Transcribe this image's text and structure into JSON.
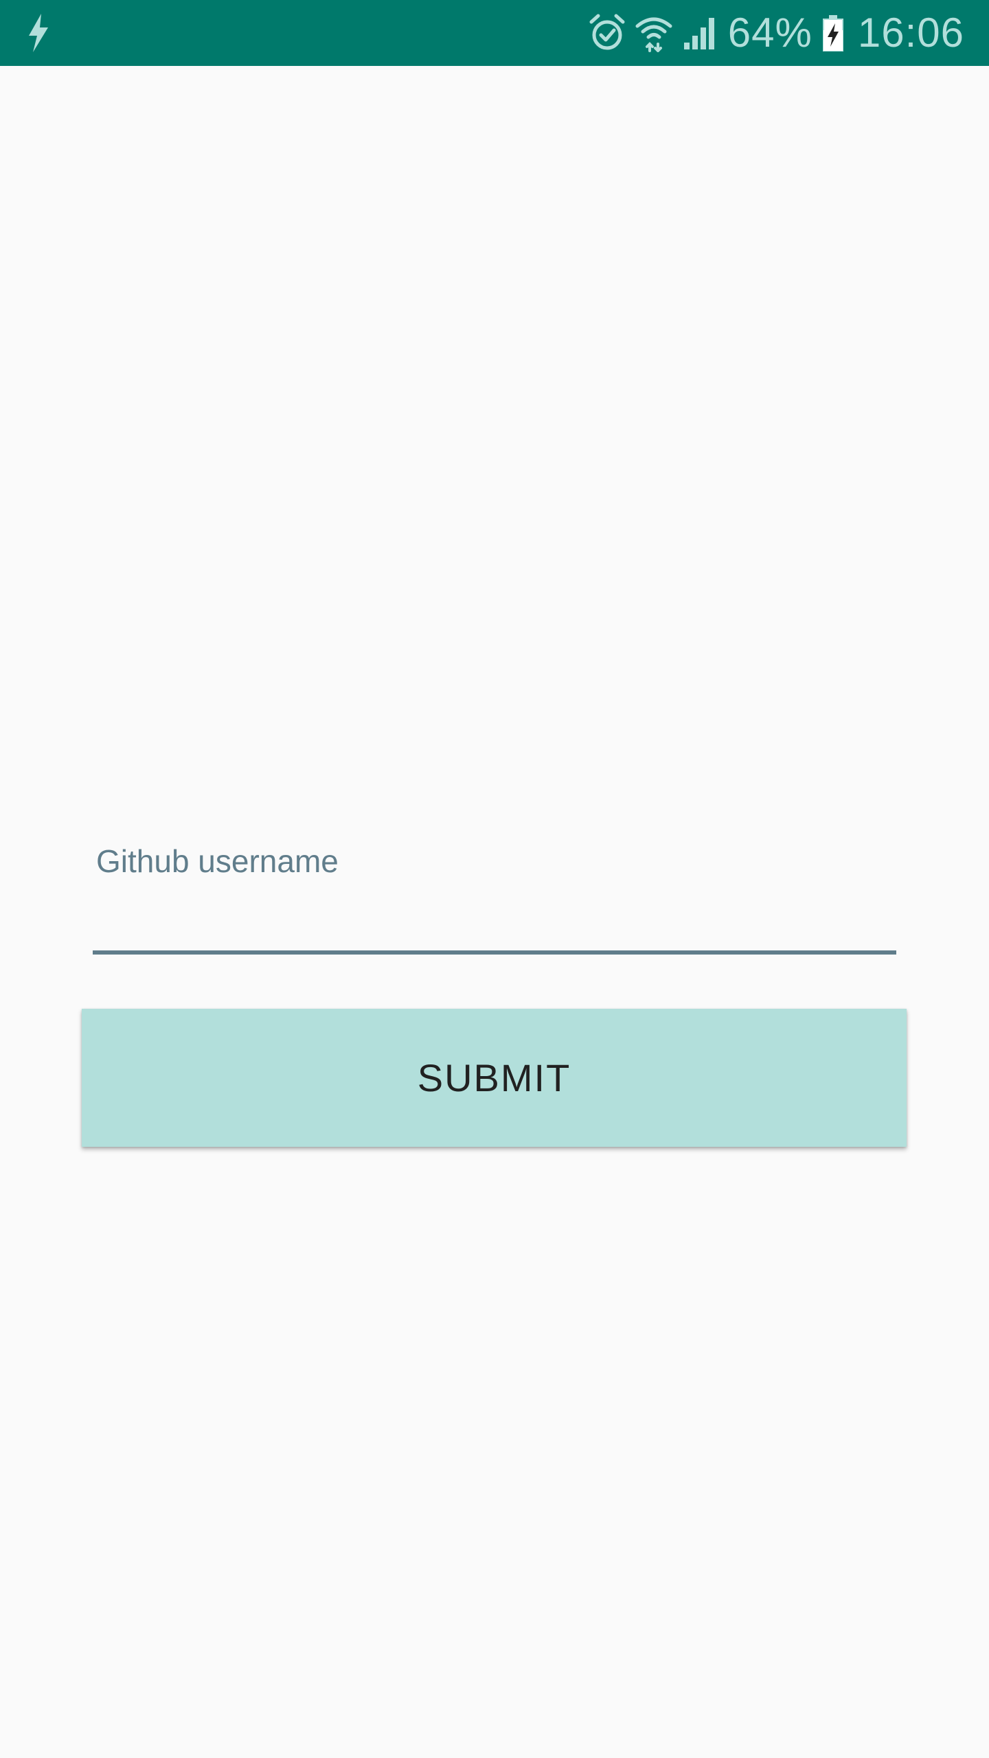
{
  "status_bar": {
    "left_icon": "flash-icon",
    "icons": [
      "alarm-icon",
      "wifi-icon",
      "signal-icon"
    ],
    "battery_percent": "64%",
    "battery_icon": "battery-charging-icon",
    "time": "16:06",
    "background_color": "#00796b",
    "icon_color": "#b2dfdb"
  },
  "form": {
    "username_label": "Github username",
    "username_value": "",
    "submit_label": "SUBMIT",
    "accent_color": "#b2dfdb",
    "underline_color": "#607d8b"
  }
}
